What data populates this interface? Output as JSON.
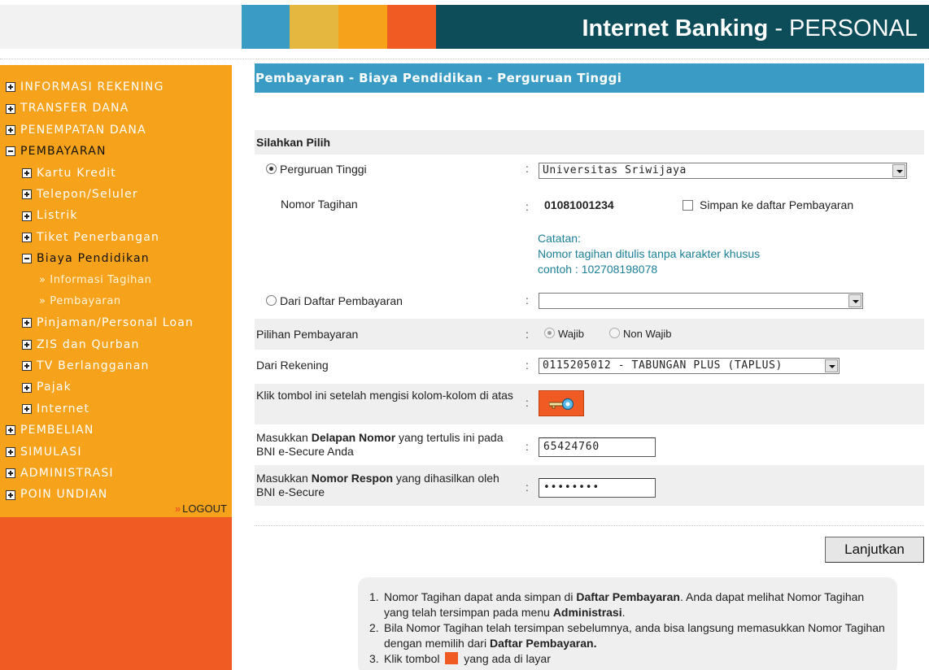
{
  "header": {
    "title_bold": "Internet Banking",
    "title_rest": " - PERSONAL",
    "colors": [
      "#3a9cc4",
      "#e5b73e",
      "#f7a21b",
      "#f05a23",
      "#0c4d59"
    ]
  },
  "sidebar": {
    "items": [
      {
        "label": "INFORMASI REKENING",
        "level": 0,
        "icon": "plus"
      },
      {
        "label": "TRANSFER DANA",
        "level": 0,
        "icon": "plus"
      },
      {
        "label": "PENEMPATAN DANA",
        "level": 0,
        "icon": "plus"
      },
      {
        "label": "PEMBAYARAN",
        "level": 0,
        "icon": "minus"
      },
      {
        "label": "Kartu Kredit",
        "level": 1,
        "icon": "plus"
      },
      {
        "label": "Telepon/Seluler",
        "level": 1,
        "icon": "plus"
      },
      {
        "label": "Listrik",
        "level": 1,
        "icon": "plus"
      },
      {
        "label": "Tiket Penerbangan",
        "level": 1,
        "icon": "plus"
      },
      {
        "label": "Biaya Pendidikan",
        "level": 1,
        "icon": "minus"
      },
      {
        "label": "» Informasi Tagihan",
        "level": 2
      },
      {
        "label": "» Pembayaran",
        "level": 2
      },
      {
        "label": "Pinjaman/Personal Loan",
        "level": 1,
        "icon": "plus"
      },
      {
        "label": "ZIS dan Qurban",
        "level": 1,
        "icon": "plus"
      },
      {
        "label": "TV Berlangganan",
        "level": 1,
        "icon": "plus"
      },
      {
        "label": "Pajak",
        "level": 1,
        "icon": "plus"
      },
      {
        "label": "Internet",
        "level": 1,
        "icon": "plus"
      },
      {
        "label": "PEMBELIAN",
        "level": 0,
        "icon": "plus"
      },
      {
        "label": "SIMULASI",
        "level": 0,
        "icon": "plus"
      },
      {
        "label": "ADMINISTRASI",
        "level": 0,
        "icon": "plus"
      },
      {
        "label": "POIN UNDIAN",
        "level": 0,
        "icon": "plus"
      }
    ],
    "logout": "LOGOUT"
  },
  "main": {
    "page_title": "Pembayaran - Biaya Pendidikan - Perguruan Tinggi",
    "section_title": "Silahkan Pilih",
    "perguruan_label": "Perguruan Tinggi",
    "perguruan_value": "Universitas Sriwijaya",
    "nomor_label": "Nomor Tagihan",
    "nomor_value": "01081001234",
    "simpan_label": "Simpan ke daftar Pembayaran",
    "catatan": [
      "Catatan:",
      "Nomor tagihan ditulis tanpa karakter khusus",
      "contoh : 102708198078"
    ],
    "daftar_label": "Dari Daftar Pembayaran",
    "daftar_value": "",
    "pilihan_label": "Pilihan Pembayaran",
    "wajib_label": "Wajib",
    "nonwajib_label": "Non Wajib",
    "rekening_label": "Dari Rekening",
    "rekening_value": "0115205012 - TABUNGAN PLUS (TAPLUS)",
    "klik_label": "Klik tombol ini setelah mengisi kolom-kolom di atas",
    "delapan_pre": "Masukkan ",
    "delapan_bold": "Delapan Nomor",
    "delapan_post": " yang tertulis ini pada BNI e-Secure Anda",
    "delapan_value": "65424760",
    "respon_pre": "Masukkan ",
    "respon_bold": "Nomor Respon",
    "respon_post": " yang dihasilkan oleh BNI e-Secure",
    "respon_value": "••••••••",
    "colon": ":",
    "next_button": "Lanjutkan"
  },
  "help": {
    "items": [
      {
        "n": "1.",
        "a": "Nomor Tagihan dapat anda simpan di ",
        "b": "Daftar Pembayaran",
        "c": ". Anda dapat melihat Nomor Tagihan yang telah tersimpan pada menu ",
        "d": "Administrasi",
        "e": "."
      },
      {
        "n": "2.",
        "a": "Bila Nomor Tagihan telah tersimpan sebelumnya, anda bisa langsung memasukkan Nomor Tagihan dengan memilih dari ",
        "b": "Daftar Pembayaran.",
        "c": "",
        "d": "",
        "e": ""
      },
      {
        "n": "3.",
        "a": "Klik tombol ",
        "b": "",
        "c": " yang ada di layar",
        "d": "",
        "e": ""
      }
    ]
  }
}
